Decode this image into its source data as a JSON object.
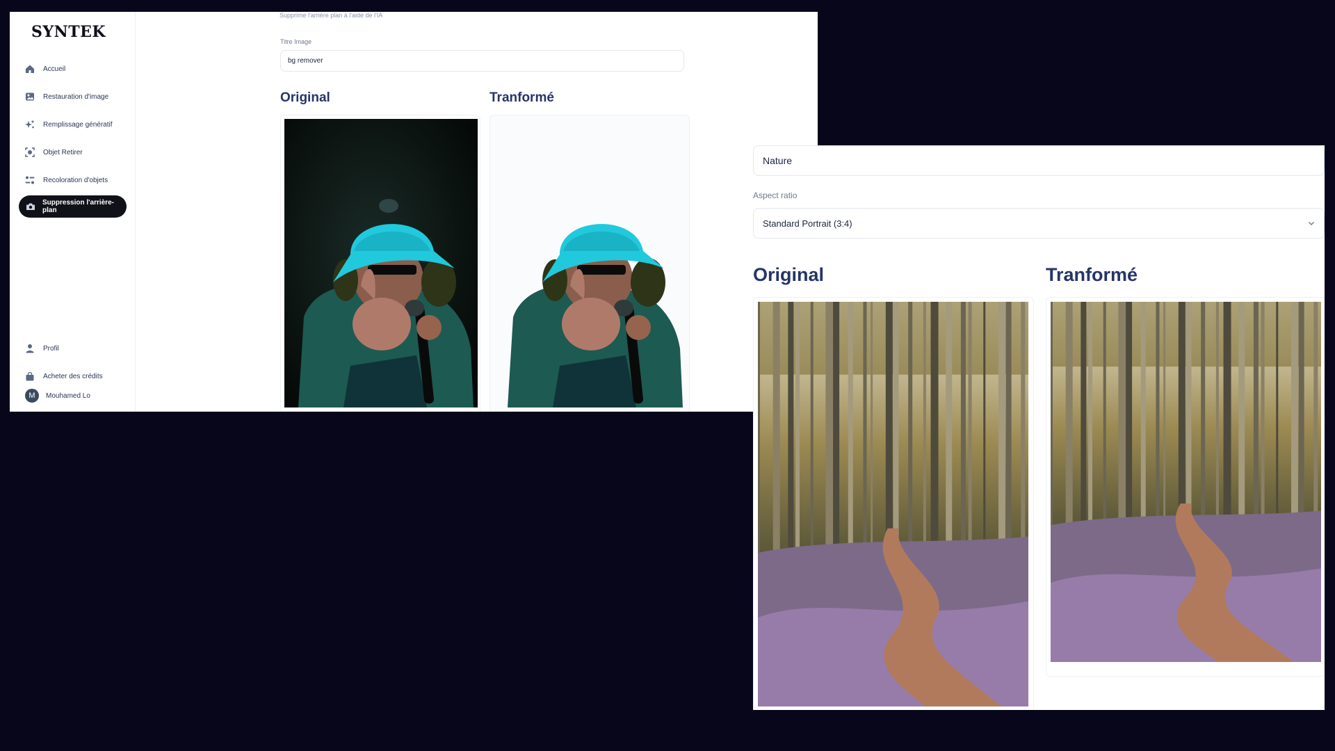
{
  "app": {
    "logo": "SYNTEK"
  },
  "sidebar": {
    "items": [
      {
        "label": "Accueil",
        "icon": "home-icon"
      },
      {
        "label": "Restauration d'image",
        "icon": "image-restore-icon"
      },
      {
        "label": "Remplissage génératif",
        "icon": "sparkles-icon"
      },
      {
        "label": "Objet Retirer",
        "icon": "scan-icon"
      },
      {
        "label": "Recoloration d'objets",
        "icon": "palette-icon"
      },
      {
        "label": "Suppression l'arrière-plan",
        "icon": "camera-icon",
        "active": true
      }
    ],
    "bottom_items": [
      {
        "label": "Profil",
        "icon": "user-icon"
      },
      {
        "label": "Acheter des crédits",
        "icon": "shopping-bag-icon"
      }
    ],
    "user": {
      "initial": "M",
      "name": "Mouhamed Lo"
    }
  },
  "window1": {
    "subtitle": "Supprime l'arrière plan à l'aide de l'IA",
    "title_field": {
      "label": "Titre Image",
      "value": "bg remover"
    },
    "original_heading": "Original",
    "transformed_heading": "Tranformé"
  },
  "window2": {
    "prompt_value": "Nature",
    "aspect_label": "Aspect ratio",
    "aspect_value": "Standard Portrait (3:4)",
    "original_heading": "Original",
    "transformed_heading": "Tranformé"
  },
  "colors": {
    "background": "#07061a",
    "heading": "#263566",
    "active_nav": "#111119",
    "accent_cyan": "#1fc6d8"
  }
}
